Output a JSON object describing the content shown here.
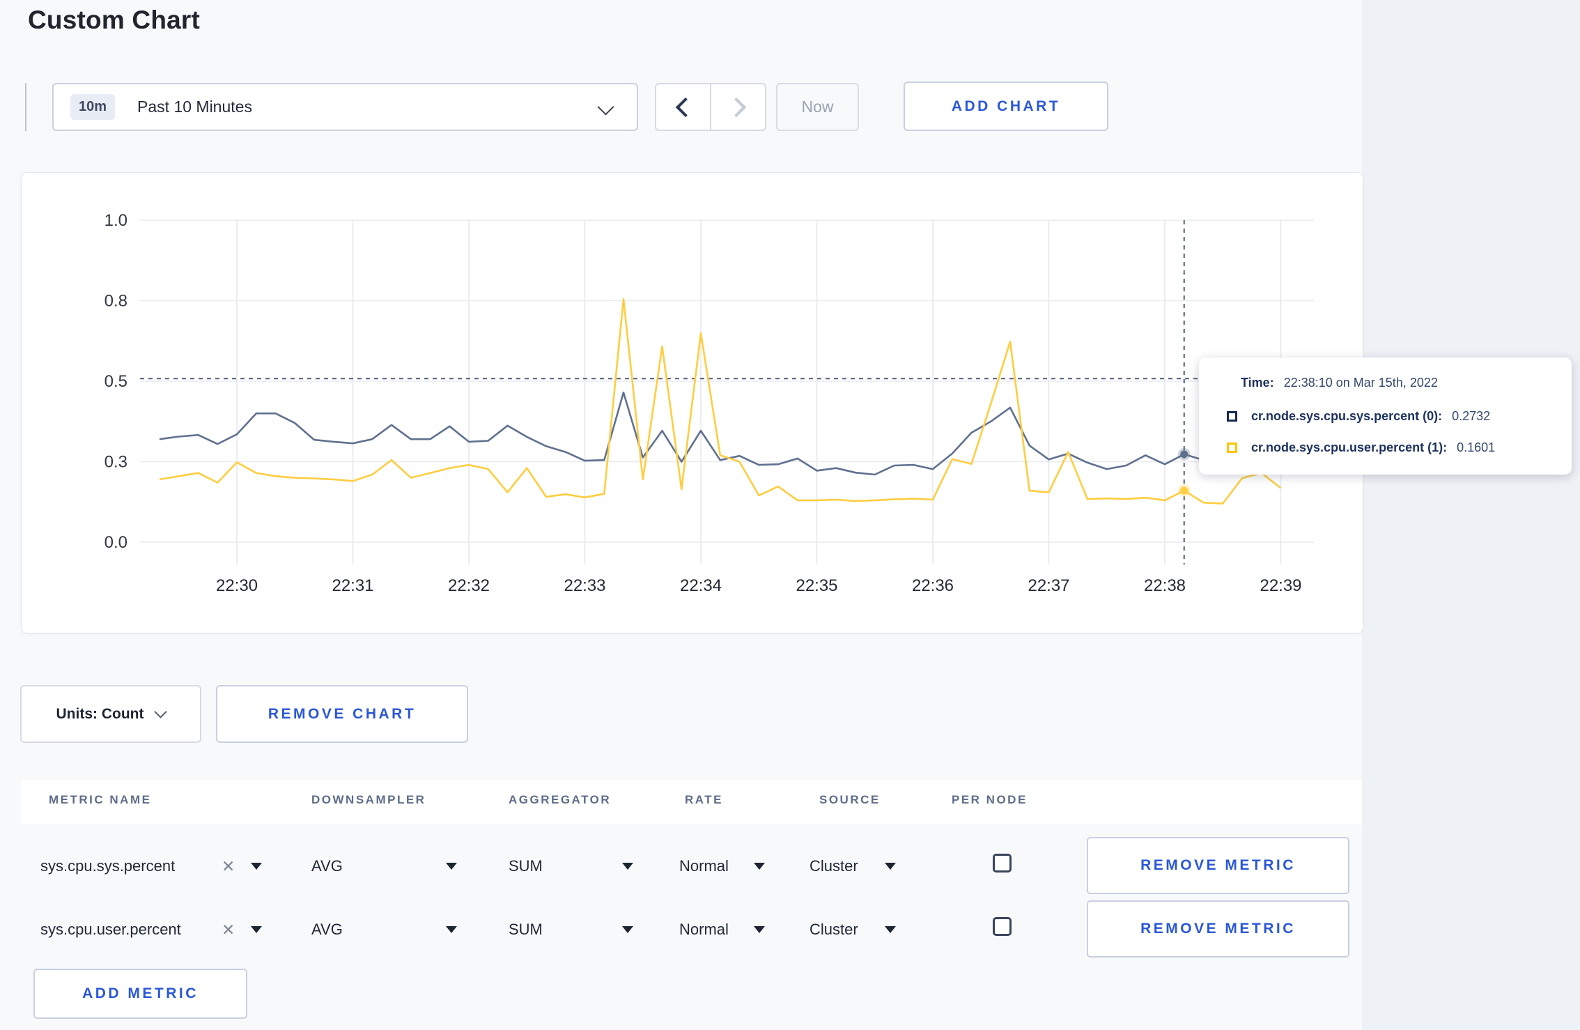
{
  "page": {
    "title": "Custom Chart"
  },
  "toolbar": {
    "range_badge": "10m",
    "range_label": "Past 10 Minutes",
    "now_label": "Now",
    "add_chart_label": "ADD CHART"
  },
  "chart": {
    "units_label": "Units: Count",
    "remove_chart_label": "REMOVE CHART",
    "tooltip": {
      "time_label": "Time:",
      "time_value": "22:38:10 on Mar 15th, 2022",
      "series": [
        {
          "name": "cr.node.sys.cpu.sys.percent (0):",
          "value": "0.2732",
          "swatch_color": "#16294e"
        },
        {
          "name": "cr.node.sys.cpu.user.percent (1):",
          "value": "0.1601",
          "swatch_color": "#ffc400"
        }
      ]
    }
  },
  "chart_data": {
    "type": "line",
    "title": "",
    "xlabel": "",
    "ylabel": "",
    "ylim": [
      0,
      1
    ],
    "grid": true,
    "legend_position": "tooltip-only",
    "y_ticks": [
      {
        "label": "1.0",
        "value": 1.0
      },
      {
        "label": "0.8",
        "value": 0.75
      },
      {
        "label": "0.5",
        "value": 0.5
      },
      {
        "label": "0.3",
        "value": 0.25
      },
      {
        "label": "0.0",
        "value": 0.0
      }
    ],
    "x_tick_labels": [
      "22:30",
      "22:31",
      "22:32",
      "22:33",
      "22:34",
      "22:35",
      "22:36",
      "22:37",
      "22:38",
      "22:39"
    ],
    "x": [
      "22:29:20",
      "22:29:30",
      "22:29:40",
      "22:29:50",
      "22:30:00",
      "22:30:10",
      "22:30:20",
      "22:30:30",
      "22:30:40",
      "22:30:50",
      "22:31:00",
      "22:31:10",
      "22:31:20",
      "22:31:30",
      "22:31:40",
      "22:31:50",
      "22:32:00",
      "22:32:10",
      "22:32:20",
      "22:32:30",
      "22:32:40",
      "22:32:50",
      "22:33:00",
      "22:33:10",
      "22:33:20",
      "22:33:30",
      "22:33:40",
      "22:33:50",
      "22:34:00",
      "22:34:10",
      "22:34:20",
      "22:34:30",
      "22:34:40",
      "22:34:50",
      "22:35:00",
      "22:35:10",
      "22:35:20",
      "22:35:30",
      "22:35:40",
      "22:35:50",
      "22:36:00",
      "22:36:10",
      "22:36:20",
      "22:36:30",
      "22:36:40",
      "22:36:50",
      "22:37:00",
      "22:37:10",
      "22:37:20",
      "22:37:30",
      "22:37:40",
      "22:37:50",
      "22:38:00",
      "22:38:10",
      "22:38:20",
      "22:38:30",
      "22:38:40",
      "22:38:50",
      "22:39:00"
    ],
    "series": [
      {
        "name": "cr.node.sys.cpu.sys.percent",
        "color": "#60708f",
        "values": [
          0.32,
          0.328,
          0.333,
          0.305,
          0.335,
          0.4,
          0.4,
          0.37,
          0.318,
          0.312,
          0.307,
          0.32,
          0.364,
          0.32,
          0.32,
          0.36,
          0.312,
          0.315,
          0.362,
          0.327,
          0.298,
          0.28,
          0.253,
          0.255,
          0.465,
          0.263,
          0.346,
          0.25,
          0.346,
          0.255,
          0.268,
          0.24,
          0.242,
          0.26,
          0.222,
          0.23,
          0.216,
          0.21,
          0.238,
          0.24,
          0.227,
          0.275,
          0.34,
          0.375,
          0.418,
          0.3,
          0.257,
          0.275,
          0.247,
          0.227,
          0.238,
          0.27,
          0.242,
          0.2732,
          0.255,
          0.26,
          0.27,
          0.28,
          0.285
        ]
      },
      {
        "name": "cr.node.sys.cpu.user.percent",
        "color": "#ffcd40",
        "values": [
          0.195,
          0.205,
          0.215,
          0.185,
          0.248,
          0.215,
          0.205,
          0.2,
          0.198,
          0.195,
          0.19,
          0.21,
          0.255,
          0.2,
          0.215,
          0.23,
          0.24,
          0.227,
          0.155,
          0.23,
          0.141,
          0.149,
          0.139,
          0.15,
          0.755,
          0.195,
          0.608,
          0.165,
          0.649,
          0.27,
          0.25,
          0.145,
          0.173,
          0.13,
          0.13,
          0.132,
          0.128,
          0.13,
          0.133,
          0.135,
          0.132,
          0.258,
          0.243,
          0.43,
          0.623,
          0.16,
          0.155,
          0.28,
          0.134,
          0.136,
          0.134,
          0.138,
          0.13,
          0.1601,
          0.123,
          0.12,
          0.199,
          0.215,
          0.168
        ]
      }
    ],
    "crosshair": {
      "time": "22:38:10",
      "hline_value": 0.508,
      "point_values": [
        0.2732,
        0.1601
      ]
    }
  },
  "metrics_table": {
    "headers": [
      "METRIC NAME",
      "DOWNSAMPLER",
      "AGGREGATOR",
      "RATE",
      "SOURCE",
      "PER NODE"
    ],
    "rows": [
      {
        "metric": "sys.cpu.sys.percent",
        "downsampler": "AVG",
        "aggregator": "SUM",
        "rate": "Normal",
        "source": "Cluster",
        "per_node_checked": false,
        "remove_label": "REMOVE METRIC"
      },
      {
        "metric": "sys.cpu.user.percent",
        "downsampler": "AVG",
        "aggregator": "SUM",
        "rate": "Normal",
        "source": "Cluster",
        "per_node_checked": false,
        "remove_label": "REMOVE METRIC"
      }
    ],
    "add_metric_label": "ADD METRIC"
  }
}
